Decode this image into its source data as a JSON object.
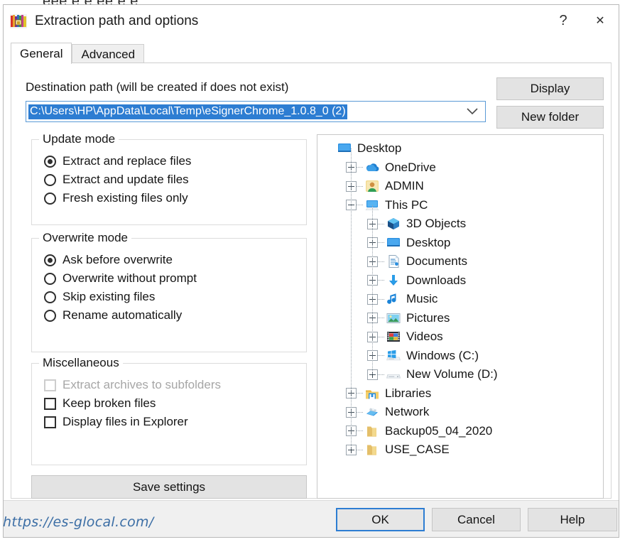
{
  "window": {
    "title": "Extraction path and options",
    "app_icon": "winrar-books-icon",
    "help_button": "?",
    "close_button": "✕"
  },
  "tabs": [
    {
      "label": "General",
      "active": true
    },
    {
      "label": "Advanced",
      "active": false
    }
  ],
  "destination": {
    "label": "Destination path (will be created if does not exist)",
    "path_value": "C:\\Users\\HP\\AppData\\Local\\Temp\\eSignerChrome_1.0.8_0 (2)",
    "selected": true,
    "dropdown_caret": "⌄"
  },
  "side_buttons": {
    "display": "Display",
    "new_folder": "New folder"
  },
  "update_mode": {
    "legend": "Update mode",
    "options": [
      {
        "label": "Extract and replace files",
        "checked": true
      },
      {
        "label": "Extract and update files",
        "checked": false
      },
      {
        "label": "Fresh existing files only",
        "checked": false
      }
    ]
  },
  "overwrite_mode": {
    "legend": "Overwrite mode",
    "options": [
      {
        "label": "Ask before overwrite",
        "checked": true
      },
      {
        "label": "Overwrite without prompt",
        "checked": false
      },
      {
        "label": "Skip existing files",
        "checked": false
      },
      {
        "label": "Rename automatically",
        "checked": false
      }
    ]
  },
  "miscellaneous": {
    "legend": "Miscellaneous",
    "options": [
      {
        "label": "Extract archives to subfolders",
        "checked": false,
        "disabled": true
      },
      {
        "label": "Keep broken files",
        "checked": false,
        "disabled": false
      },
      {
        "label": "Display files in Explorer",
        "checked": false,
        "disabled": false
      }
    ]
  },
  "save_settings_button": "Save settings",
  "folder_tree": [
    {
      "label": "Desktop",
      "depth": 0,
      "expander": "none",
      "icon": "desktop-icon"
    },
    {
      "label": "OneDrive",
      "depth": 1,
      "expander": "plus",
      "icon": "onedrive-cloud-icon"
    },
    {
      "label": "ADMIN",
      "depth": 1,
      "expander": "plus",
      "icon": "user-account-icon"
    },
    {
      "label": "This PC",
      "depth": 1,
      "expander": "minus",
      "icon": "this-pc-icon"
    },
    {
      "label": "3D Objects",
      "depth": 2,
      "expander": "plus",
      "icon": "3d-objects-icon"
    },
    {
      "label": "Desktop",
      "depth": 2,
      "expander": "plus",
      "icon": "desktop-icon"
    },
    {
      "label": "Documents",
      "depth": 2,
      "expander": "plus",
      "icon": "documents-icon"
    },
    {
      "label": "Downloads",
      "depth": 2,
      "expander": "plus",
      "icon": "downloads-arrow-icon"
    },
    {
      "label": "Music",
      "depth": 2,
      "expander": "plus",
      "icon": "music-note-icon"
    },
    {
      "label": "Pictures",
      "depth": 2,
      "expander": "plus",
      "icon": "pictures-icon"
    },
    {
      "label": "Videos",
      "depth": 2,
      "expander": "plus",
      "icon": "videos-film-icon"
    },
    {
      "label": "Windows (C:)",
      "depth": 2,
      "expander": "plus",
      "icon": "windows-drive-icon"
    },
    {
      "label": "New Volume (D:)",
      "depth": 2,
      "expander": "plus",
      "icon": "hard-drive-icon"
    },
    {
      "label": "Libraries",
      "depth": 1,
      "expander": "plus",
      "icon": "libraries-icon"
    },
    {
      "label": "Network",
      "depth": 1,
      "expander": "plus",
      "icon": "network-icon"
    },
    {
      "label": "Backup05_04_2020",
      "depth": 1,
      "expander": "plus",
      "icon": "folder-icon"
    },
    {
      "label": "USE_CASE",
      "depth": 1,
      "expander": "plus",
      "icon": "folder-icon"
    }
  ],
  "bottom_buttons": {
    "ok": "OK",
    "cancel": "Cancel",
    "help": "Help"
  },
  "watermark": {
    "url": "https://es-glocal.com/",
    "text": "GLOCAL",
    "top_sliver": "eee e e  ee e  e"
  },
  "colors": {
    "accent_blue": "#2d7dd2",
    "selection_blue": "#2d7dd2",
    "button_face": "#e3e3e3",
    "dialog_bg": "#ffffff",
    "watermark_blue": "#3c6ea5"
  }
}
